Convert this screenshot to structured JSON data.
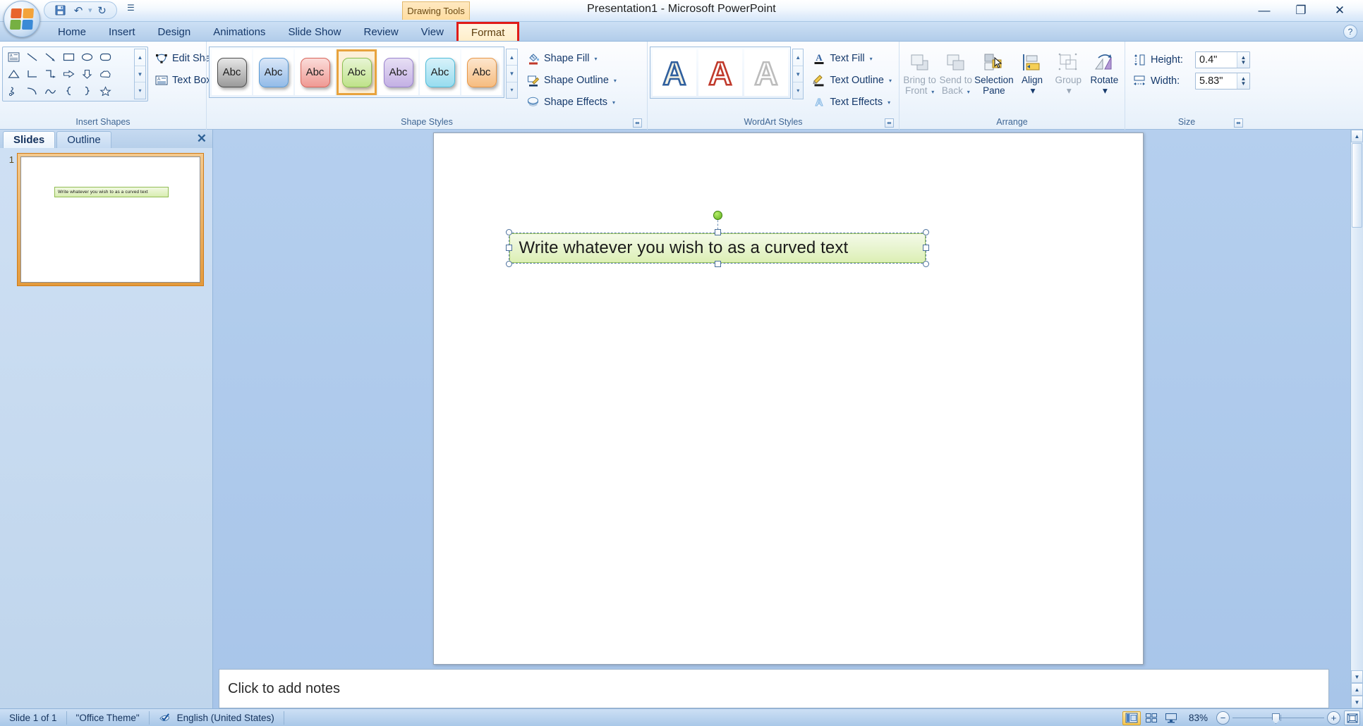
{
  "window": {
    "title": "Presentation1 - Microsoft PowerPoint",
    "minimize": "—",
    "maximize": "❐",
    "close": "✕",
    "help": "?"
  },
  "quick_access": {
    "save": "💾",
    "undo": "↶",
    "undo_caret": "▾",
    "redo": "↻",
    "customize": "☰"
  },
  "context_tab_label": "Drawing Tools",
  "tabs": [
    {
      "label": "Home",
      "active": false
    },
    {
      "label": "Insert",
      "active": false
    },
    {
      "label": "Design",
      "active": false
    },
    {
      "label": "Animations",
      "active": false
    },
    {
      "label": "Slide Show",
      "active": false
    },
    {
      "label": "Review",
      "active": false
    },
    {
      "label": "View",
      "active": false
    },
    {
      "label": "Format",
      "active": true
    }
  ],
  "ribbon": {
    "insert_shapes": {
      "label": "Insert Shapes",
      "shapes": [
        "textbox-shape-icon",
        "line-shape-icon",
        "arrow-shape-icon",
        "rectangle-shape-icon",
        "oval-shape-icon",
        "rounded-rectangle-shape-icon",
        "triangle-shape-icon",
        "elbow-connector-shape-icon",
        "elbow-arrow-connector-shape-icon",
        "right-arrow-shape-icon",
        "down-arrow-shape-icon",
        "cloud-shape-icon",
        "scribble-shape-icon",
        "arc-shape-icon",
        "curve-shape-icon",
        "left-brace-shape-icon",
        "right-brace-shape-icon",
        "star-shape-icon"
      ],
      "scroll_up": "▲",
      "scroll_down": "▼",
      "more": "▾",
      "commands": [
        {
          "label": "Edit Shape",
          "icon": "edit-shape-icon",
          "has_caret": true
        },
        {
          "label": "Text Box",
          "icon": "text-box-icon",
          "has_caret": false
        }
      ]
    },
    "shape_styles": {
      "label": "Shape Styles",
      "dialog_launcher": "⬌",
      "scroll_up": "▲",
      "scroll_down": "▼",
      "more": "▾",
      "swatch_text": "Abc",
      "swatches": [
        {
          "name": "style-dark-gray",
          "top": "#e6e6e6",
          "bottom": "#9a9a9a",
          "border": "#4d4d4d",
          "selected": false
        },
        {
          "name": "style-blue",
          "top": "#dae7f8",
          "bottom": "#93bbe8",
          "border": "#5b9bd5",
          "selected": false
        },
        {
          "name": "style-red",
          "top": "#fbdcd9",
          "bottom": "#ef9a94",
          "border": "#d9665c",
          "selected": false
        },
        {
          "name": "style-green",
          "top": "#e8f5d4",
          "bottom": "#bfe28a",
          "border": "#8cc152",
          "selected": true
        },
        {
          "name": "style-purple",
          "top": "#e7dff4",
          "bottom": "#c3b0e4",
          "border": "#9b84cf",
          "selected": false
        },
        {
          "name": "style-teal",
          "top": "#d8f2fa",
          "bottom": "#97dcef",
          "border": "#4fbcd9",
          "selected": false
        },
        {
          "name": "style-orange",
          "top": "#fde6cd",
          "bottom": "#f6bc80",
          "border": "#e89748",
          "selected": false
        }
      ],
      "commands": [
        {
          "label": "Shape Fill",
          "icon": "shape-fill-icon",
          "has_caret": true
        },
        {
          "label": "Shape Outline",
          "icon": "shape-outline-icon",
          "has_caret": true
        },
        {
          "label": "Shape Effects",
          "icon": "shape-effects-icon",
          "has_caret": true
        }
      ]
    },
    "wordart_styles": {
      "label": "WordArt Styles",
      "dialog_launcher": "⬌",
      "scroll_up": "▲",
      "scroll_down": "▼",
      "more": "▾",
      "swatches": [
        {
          "name": "wordart-blue",
          "letter": "A",
          "fill": "#f4f1e2",
          "outline": "#2f5f9e"
        },
        {
          "name": "wordart-red",
          "letter": "A",
          "fill": "#ffffff",
          "outline": "#c0392b"
        },
        {
          "name": "wordart-gray",
          "letter": "A",
          "fill": "#ffffff",
          "outline": "#b7b7b7"
        }
      ],
      "commands": [
        {
          "label": "Text Fill",
          "icon": "text-fill-icon",
          "has_caret": true
        },
        {
          "label": "Text Outline",
          "icon": "text-outline-icon",
          "has_caret": true
        },
        {
          "label": "Text Effects",
          "icon": "text-effects-icon",
          "has_caret": true
        }
      ]
    },
    "arrange": {
      "label": "Arrange",
      "buttons": [
        {
          "name": "bring-to-front-button",
          "line1": "Bring to",
          "line2": "Front",
          "icon": "bring-to-front-icon",
          "disabled": true,
          "has_caret": true
        },
        {
          "name": "send-to-back-button",
          "line1": "Send to",
          "line2": "Back",
          "icon": "send-to-back-icon",
          "disabled": true,
          "has_caret": true
        },
        {
          "name": "selection-pane-button",
          "line1": "Selection",
          "line2": "Pane",
          "icon": "selection-pane-icon",
          "disabled": false,
          "has_caret": false
        },
        {
          "name": "align-button",
          "line1": "Align",
          "line2": "",
          "icon": "align-icon",
          "disabled": false,
          "has_caret": true
        },
        {
          "name": "group-button",
          "line1": "Group",
          "line2": "",
          "icon": "group-icon",
          "disabled": true,
          "has_caret": true
        },
        {
          "name": "rotate-button",
          "line1": "Rotate",
          "line2": "",
          "icon": "rotate-icon",
          "disabled": false,
          "has_caret": true
        }
      ]
    },
    "size": {
      "label": "Size",
      "dialog_launcher": "⬌",
      "height_label": "Height:",
      "height_value": "0.4\"",
      "width_label": "Width:",
      "width_value": "5.83\"",
      "spinner_up": "▲",
      "spinner_down": "▼"
    }
  },
  "slides_pane": {
    "tabs": [
      {
        "label": "Slides",
        "active": true
      },
      {
        "label": "Outline",
        "active": false
      }
    ],
    "close": "✕",
    "thumbnail": {
      "number": "1",
      "shape_text": "Write whatever you wish to as a curved text"
    }
  },
  "slide": {
    "shape_text": "Write whatever you wish to as a curved text"
  },
  "notes": {
    "placeholder": "Click to add notes"
  },
  "scrollbar": {
    "up": "▲",
    "down": "▼",
    "prev": "▲",
    "next": "▼"
  },
  "status_bar": {
    "slide_count": "Slide 1 of 1",
    "theme": "\"Office Theme\"",
    "spellcheck_icon": "spellcheck-icon",
    "language": "English (United States)",
    "views": [
      {
        "name": "normal-view-button",
        "icon": "normal-view-icon",
        "active": true
      },
      {
        "name": "slide-sorter-view-button",
        "icon": "slide-sorter-icon",
        "active": false
      },
      {
        "name": "slide-show-view-button",
        "icon": "slide-show-icon",
        "active": false
      }
    ],
    "zoom_level": "83%",
    "zoom_out": "−",
    "zoom_in": "+",
    "fit_to_window": "fit-slide-icon"
  }
}
